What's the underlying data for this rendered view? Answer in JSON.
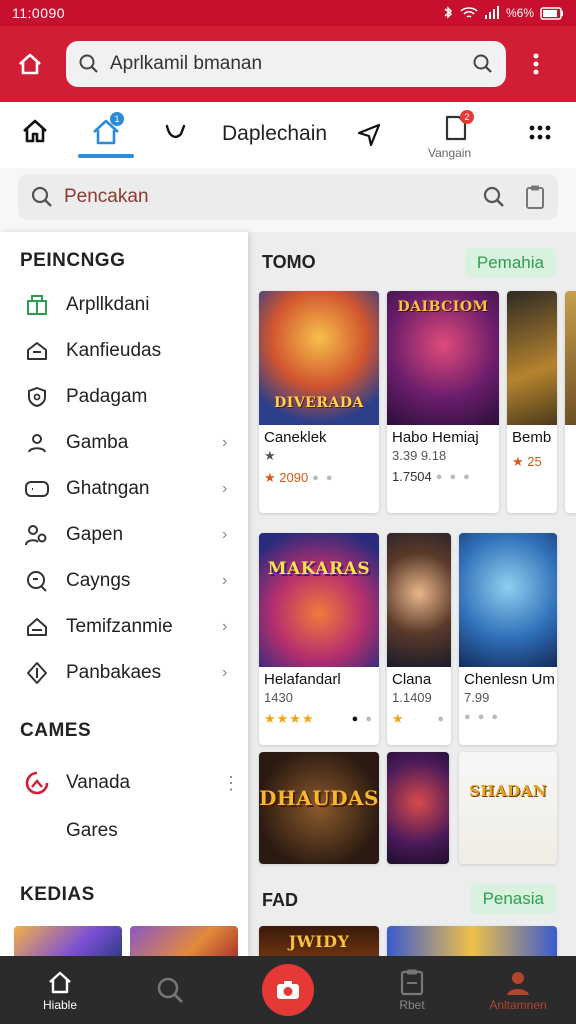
{
  "status_bar": {
    "time": "11:0090",
    "battery": "%6%"
  },
  "top_bar": {
    "url_text": "Aprlkamil bmanan"
  },
  "nav2": {
    "brand": "Daplechain",
    "account_label": "Vangain",
    "home_badge": "1",
    "account_badge": "2"
  },
  "search": {
    "placeholder": "Pencakan"
  },
  "drawer": {
    "section1_title": "PEINCNGG",
    "items": [
      {
        "label": "Arpllkdani",
        "icon": "gift-box-icon",
        "chevron": false
      },
      {
        "label": "Kanfieudas",
        "icon": "house-outline-icon",
        "chevron": false
      },
      {
        "label": "Padagam",
        "icon": "shield-icon",
        "chevron": false
      },
      {
        "label": "Gamba",
        "icon": "person-icon",
        "chevron": true
      },
      {
        "label": "Ghatngan",
        "icon": "gamepad-icon",
        "chevron": true
      },
      {
        "label": "Gapen",
        "icon": "people-icon",
        "chevron": true
      },
      {
        "label": "Cayngs",
        "icon": "search-circle-icon",
        "chevron": true
      },
      {
        "label": "Temifzanmie",
        "icon": "house-icon",
        "chevron": true
      },
      {
        "label": "Panbakaes",
        "icon": "diamond-icon",
        "chevron": true
      }
    ],
    "section2_title": "CAMES",
    "games": [
      {
        "label": "Vanada",
        "icon": "spinner-icon"
      },
      {
        "label": "Gares"
      }
    ],
    "section3_title": "KEDIAS"
  },
  "content": {
    "section1_title": "TOMO",
    "section1_pill": "Pemahia",
    "row1": [
      {
        "art_title": "DIVERADA",
        "name": "Caneklek",
        "meta": "",
        "rating": "★",
        "price": "★ 2090",
        "dots": "● ●"
      },
      {
        "art_title": "DAIBCIOM",
        "name": "Habo Hemiaj",
        "meta": "3.39   9.18",
        "price": "1.7504",
        "dots": "● ● ●"
      },
      {
        "art_title": "",
        "name": "Bemb",
        "meta": "",
        "price": "★ 25",
        "dots": ""
      }
    ],
    "row2": [
      {
        "art_title": "MAKARAS",
        "name": "Helafandarl",
        "meta": "1430",
        "rating": "★★★★",
        "dots": "● ●"
      },
      {
        "art_title": "",
        "name": "Clana",
        "meta": "1.1409",
        "rating": "★",
        "dots": "●"
      },
      {
        "art_title": "",
        "name": "Chenlesn Um",
        "meta": "7.99",
        "dots": "● ● ●"
      }
    ],
    "row3": [
      {
        "art_title": "DHAUDAS"
      },
      {
        "art_title": ""
      },
      {
        "art_title": "SHADAN"
      }
    ],
    "section2_title": "FAD",
    "section2_pill": "Penasia",
    "row4_art": "JWIDY"
  },
  "bottom_nav": {
    "items": [
      {
        "label": "Hiable",
        "icon": "home-icon"
      },
      {
        "label": "",
        "icon": "search-icon"
      },
      {
        "label": "",
        "icon": "camera-icon"
      },
      {
        "label": "Rbet",
        "icon": "clipboard-icon"
      },
      {
        "label": "Anltamnen",
        "icon": "profile-icon"
      }
    ]
  },
  "colors": {
    "brand_red": "#d21e35",
    "accent_blue": "#2a8cd8",
    "pill_green": "#2e9e4f"
  }
}
